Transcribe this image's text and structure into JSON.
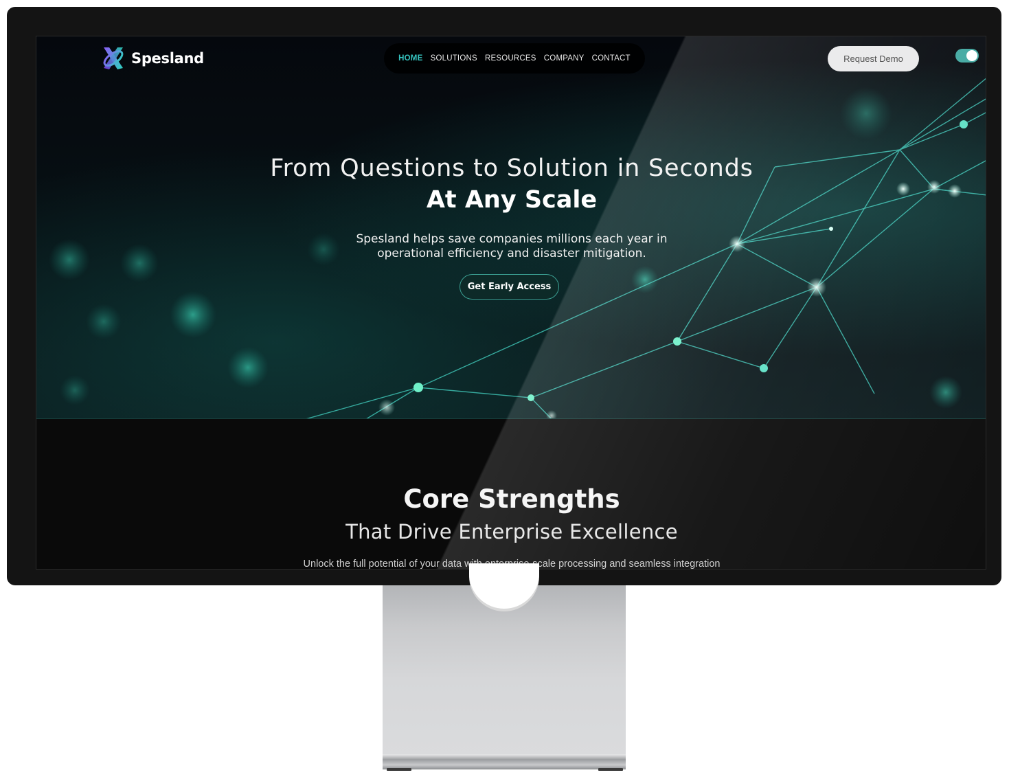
{
  "brand": {
    "name": "Spesland"
  },
  "nav": {
    "items": [
      {
        "label": "HOME",
        "active": true
      },
      {
        "label": "SOLUTIONS",
        "active": false
      },
      {
        "label": "RESOURCES",
        "active": false
      },
      {
        "label": "COMPANY",
        "active": false
      },
      {
        "label": "CONTACT",
        "active": false
      }
    ]
  },
  "header": {
    "request_demo_label": "Request Demo",
    "theme_toggle_on": true
  },
  "hero": {
    "title_line1": "From Questions to Solution in Seconds",
    "title_line2": "At Any Scale",
    "subtitle": "Spesland helps save companies millions each year in operational efficiency and disaster mitigation.",
    "cta_label": "Get Early Access"
  },
  "core": {
    "title": "Core Strengths",
    "subtitle": "That Drive Enterprise Excellence",
    "description": "Unlock the full potential of your data with enterprise-scale processing and seamless integration"
  },
  "colors": {
    "accent": "#35c4c0",
    "cta_border": "#3b9e92",
    "background": "#0a0a0a"
  }
}
